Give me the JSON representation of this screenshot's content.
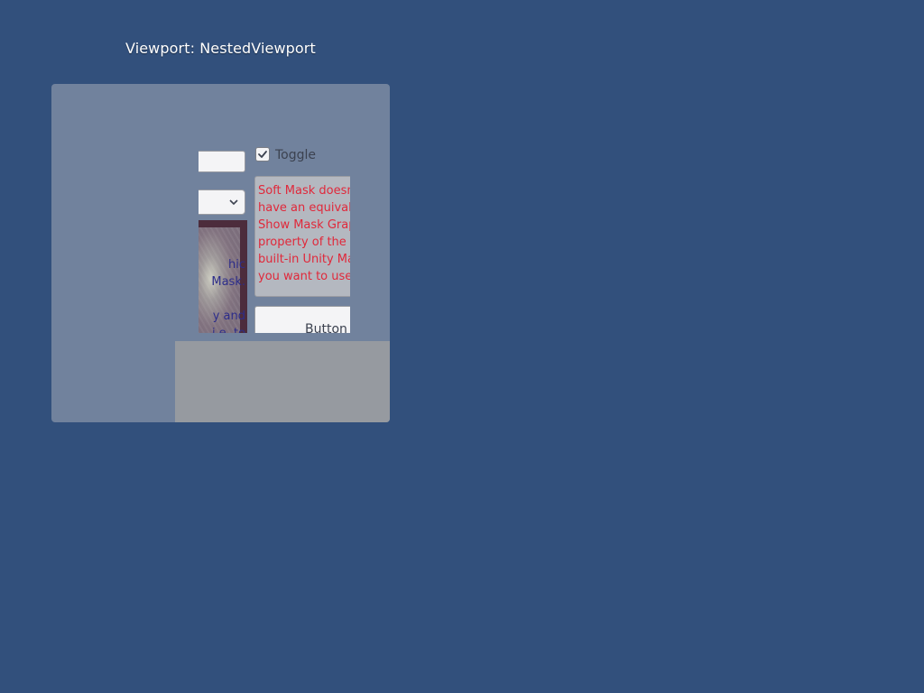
{
  "viewport_title": "Viewport: NestedViewport",
  "controls": {
    "toggle_label": "Toggle",
    "toggle_checked": true,
    "button_label": "Button",
    "note_text": "Soft Mask doesn't\nhave an equivalent\nShow Mask Graphic\nproperty of the\nbuilt-in Unity Mask.\nyou want to use",
    "image_text": "hic\nMask.\n\ny and\ni.e. to"
  },
  "colors": {
    "background": "#32507c",
    "outer_panel": "#71829d",
    "bottom_panel": "#969aa0",
    "note_text": "#e0283a",
    "image_text": "#2d2d8a"
  },
  "icons": {
    "toggle_check": "check-icon",
    "dropdown_arrow": "chevron-down-icon"
  }
}
